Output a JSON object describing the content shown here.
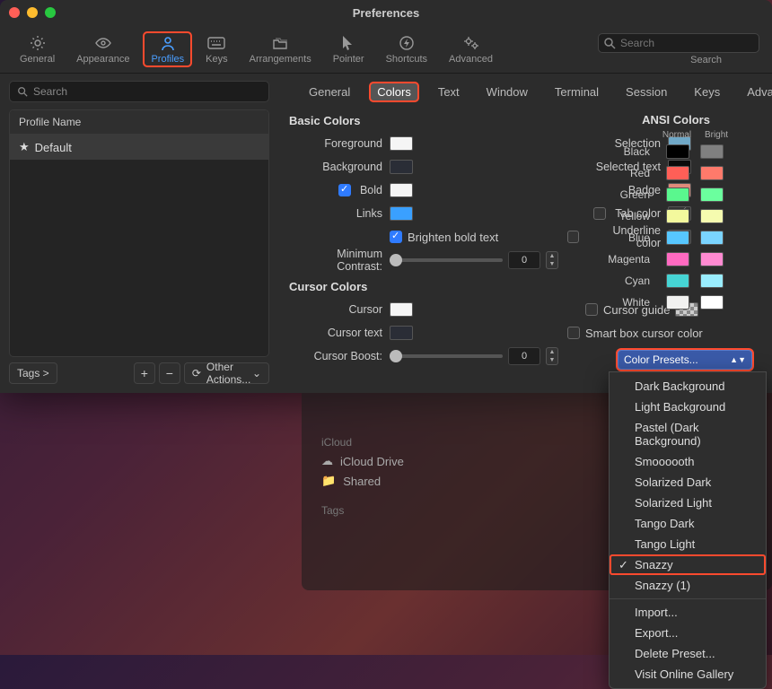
{
  "window": {
    "title": "Preferences"
  },
  "toolbar": {
    "items": [
      {
        "label": "General"
      },
      {
        "label": "Appearance"
      },
      {
        "label": "Profiles"
      },
      {
        "label": "Keys"
      },
      {
        "label": "Arrangements"
      },
      {
        "label": "Pointer"
      },
      {
        "label": "Shortcuts"
      },
      {
        "label": "Advanced"
      }
    ],
    "search_placeholder": "Search",
    "search_label": "Search"
  },
  "sidebar": {
    "search_placeholder": "Search",
    "header": "Profile Name",
    "items": [
      {
        "label": "Default"
      }
    ],
    "tags_label": "Tags >",
    "other_actions": "Other Actions..."
  },
  "tabs": [
    "General",
    "Colors",
    "Text",
    "Window",
    "Terminal",
    "Session",
    "Keys",
    "Advanced"
  ],
  "basic": {
    "heading": "Basic Colors",
    "foreground": "Foreground",
    "foreground_color": "#f5f5f5",
    "background": "Background",
    "background_color": "#2a2d36",
    "bold": "Bold",
    "bold_checked": true,
    "bold_color": "#f5f5f5",
    "links": "Links",
    "links_color": "#3aa0ff",
    "brighten": "Brighten bold text",
    "brighten_checked": true,
    "min_contrast": "Minimum Contrast:",
    "min_contrast_val": "0",
    "selection": "Selection",
    "selection_color": "#6fa8c7",
    "selected_text": "Selected text",
    "selected_text_color": "#0a0a0a",
    "badge": "Badge",
    "badge_color": "#e08a7a",
    "tab_color": "Tab color",
    "underline": "Underline color"
  },
  "cursor": {
    "heading": "Cursor Colors",
    "cursor": "Cursor",
    "cursor_color": "#f5f5f5",
    "cursor_text": "Cursor text",
    "cursor_text_color": "#2a2d36",
    "cursor_boost": "Cursor Boost:",
    "cursor_boost_val": "0",
    "cursor_guide": "Cursor guide",
    "smart_box": "Smart box cursor color"
  },
  "ansi": {
    "heading": "ANSI Colors",
    "normal": "Normal",
    "bright": "Bright",
    "rows": [
      {
        "name": "Black",
        "n": "#000000",
        "b": "#808080"
      },
      {
        "name": "Red",
        "n": "#ff5f57",
        "b": "#ff7a6b"
      },
      {
        "name": "Green",
        "n": "#5af78e",
        "b": "#6bff9e"
      },
      {
        "name": "Yellow",
        "n": "#f3f99d",
        "b": "#f5fbaf"
      },
      {
        "name": "Blue",
        "n": "#57c7ff",
        "b": "#7ad4ff"
      },
      {
        "name": "Magenta",
        "n": "#ff6ac1",
        "b": "#ff8ad1"
      },
      {
        "name": "Cyan",
        "n": "#46d4d4",
        "b": "#9aedfe"
      },
      {
        "name": "White",
        "n": "#f1f1f0",
        "b": "#ffffff"
      }
    ]
  },
  "preset": {
    "label": "Color Presets...",
    "options": [
      "Dark Background",
      "Light Background",
      "Pastel (Dark Background)",
      "Smoooooth",
      "Solarized Dark",
      "Solarized Light",
      "Tango Dark",
      "Tango Light",
      "Snazzy",
      "Snazzy (1)",
      "Import...",
      "Export...",
      "Delete Preset...",
      "Visit Online Gallery"
    ],
    "selected": "Snazzy"
  },
  "bgpanel": {
    "group1": "iCloud",
    "items": [
      "iCloud Drive",
      "Shared"
    ],
    "group2": "Tags"
  }
}
